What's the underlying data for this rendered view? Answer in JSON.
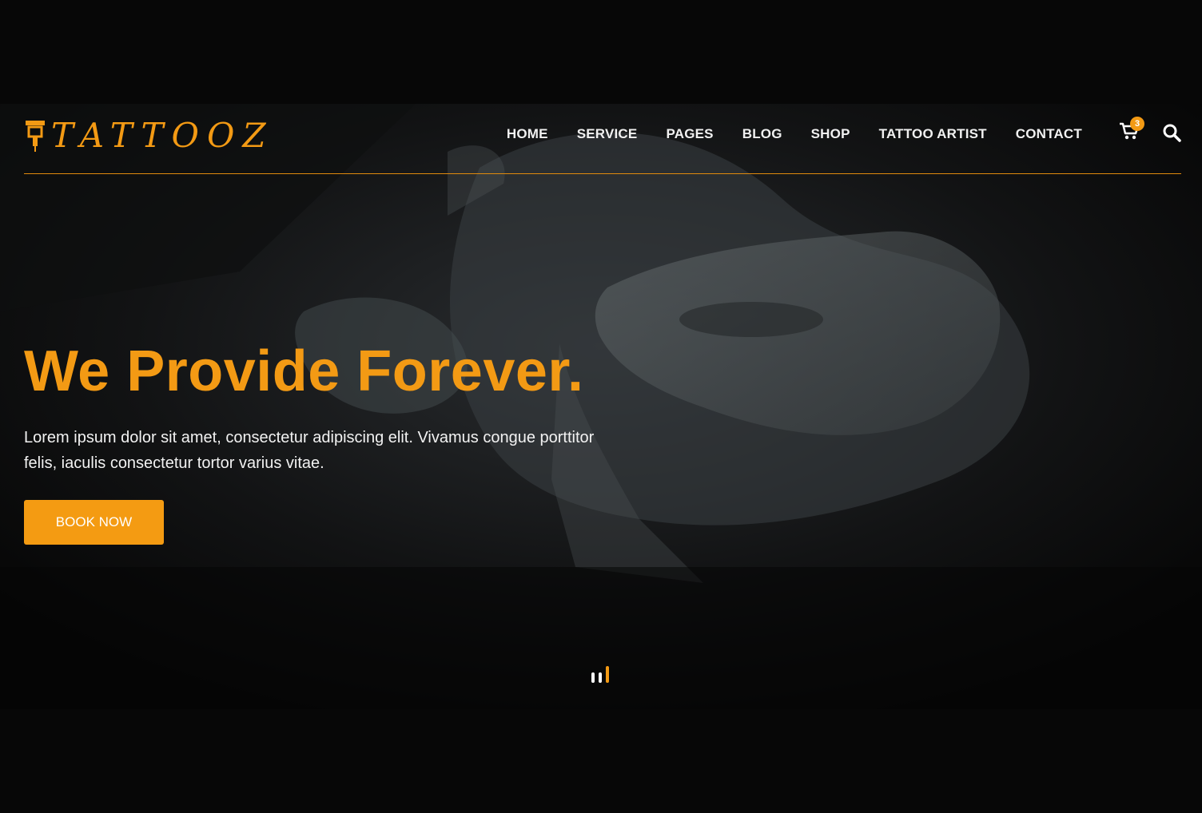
{
  "brand": {
    "logo_text": "TATTOOZ",
    "accent_color": "#f39a14"
  },
  "nav": {
    "items": [
      {
        "label": "HOME"
      },
      {
        "label": "SERVICE"
      },
      {
        "label": "PAGES"
      },
      {
        "label": "BLOG"
      },
      {
        "label": "SHOP"
      },
      {
        "label": "TATTOO ARTIST"
      },
      {
        "label": "CONTACT"
      }
    ],
    "cart_icon": "cart-icon",
    "cart_count": "3",
    "search_icon": "search-icon"
  },
  "hero": {
    "headline": "We Provide Forever.",
    "lead": "Lorem ipsum dolor sit amet, consectetur adipiscing elit. Vivamus congue porttitor felis, iaculis consectetur tortor varius vitae.",
    "cta_label": "BOOK NOW"
  },
  "slider": {
    "slides": 3,
    "active_slide": 3
  }
}
